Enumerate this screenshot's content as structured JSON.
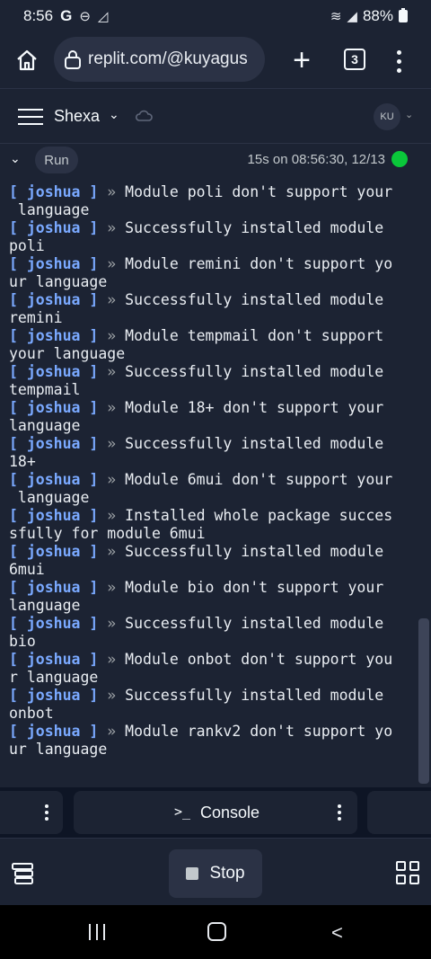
{
  "status_bar": {
    "time": "8:56",
    "g_icon": "G",
    "battery": "88%"
  },
  "browser": {
    "url": "replit.com/@kuyagus",
    "tab_count": "3"
  },
  "app_header": {
    "project_name": "Shexa",
    "avatar_initials": "KU"
  },
  "run_bar": {
    "run_label": "Run",
    "status_text": "15s on 08:56:30, 12/13",
    "status_color": "#0ac73a"
  },
  "console": {
    "tag": "[ joshua ]",
    "arrow": "»",
    "lines": [
      {
        "tag": true,
        "text": " Module poli don't support your"
      },
      {
        "tag": false,
        "text": " language"
      },
      {
        "tag": true,
        "text": " Successfully installed module"
      },
      {
        "tag": false,
        "text": "poli"
      },
      {
        "tag": true,
        "text": " Module remini don't support yo"
      },
      {
        "tag": false,
        "text": "ur language"
      },
      {
        "tag": true,
        "text": " Successfully installed module"
      },
      {
        "tag": false,
        "text": "remini"
      },
      {
        "tag": true,
        "text": " Module tempmail don't support"
      },
      {
        "tag": false,
        "text": "your language"
      },
      {
        "tag": true,
        "text": " Successfully installed module"
      },
      {
        "tag": false,
        "text": "tempmail"
      },
      {
        "tag": true,
        "text": " Module 18+ don't support your"
      },
      {
        "tag": false,
        "text": "language"
      },
      {
        "tag": true,
        "text": " Successfully installed module"
      },
      {
        "tag": false,
        "text": "18+"
      },
      {
        "tag": true,
        "text": " Module 6mui don't support your"
      },
      {
        "tag": false,
        "text": " language"
      },
      {
        "tag": true,
        "text": " Installed whole package succes"
      },
      {
        "tag": false,
        "text": "sfully for module 6mui"
      },
      {
        "tag": true,
        "text": " Successfully installed module"
      },
      {
        "tag": false,
        "text": "6mui"
      },
      {
        "tag": true,
        "text": " Module bio don't support your"
      },
      {
        "tag": false,
        "text": "language"
      },
      {
        "tag": true,
        "text": " Successfully installed module"
      },
      {
        "tag": false,
        "text": "bio"
      },
      {
        "tag": true,
        "text": " Module onbot don't support you"
      },
      {
        "tag": false,
        "text": "r language"
      },
      {
        "tag": true,
        "text": " Successfully installed module"
      },
      {
        "tag": false,
        "text": "onbot"
      },
      {
        "tag": true,
        "text": " Module rankv2 don't support yo"
      },
      {
        "tag": false,
        "text": "ur language"
      }
    ]
  },
  "panel_tabs": {
    "console_label": "Console",
    "prompt_glyph": ">_"
  },
  "bottom_bar": {
    "stop_label": "Stop"
  }
}
